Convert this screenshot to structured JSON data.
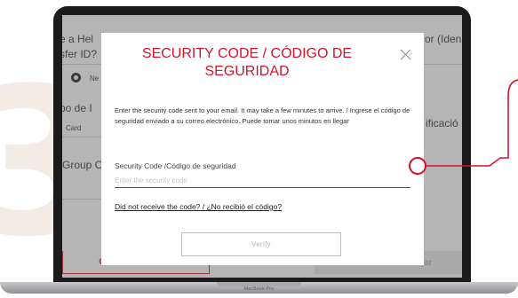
{
  "background_form": {
    "row1_left_text": "e a Hel",
    "row1_left_text2": "sfer ID?",
    "row1_right_text": "or (Iden",
    "radio_label": "Ne",
    "row2_left_text": "po de I",
    "row2_left_text2": "Card",
    "row2_right_text": "ificació",
    "row3_left_text": "Group C",
    "cancel_label": "Cancel / Cancelar",
    "continue_label": "Continue / Continuar"
  },
  "modal": {
    "title": "SECURITY CODE / CÓDIGO DE SEGURIDAD",
    "instructions": "Enter the security code sent to your email. It may take a few minutes to arrive. / Ingrese el código de seguridad enviado a su correo electrónico. Puede tomar unos minutos en llegar",
    "field_label": "Security Code /Código de seguridad",
    "input_placeholder": "Enter the security code",
    "input_value": "",
    "resend_link": "Did not receive the code? / ¿No recibió el código?",
    "verify_label": "Verify"
  },
  "laptop": {
    "model_label": "MacBook Pro"
  },
  "colors": {
    "accent_red": "#d2152c",
    "digit_beige": "#f3ece6"
  },
  "icons": {
    "close": "close-icon"
  }
}
